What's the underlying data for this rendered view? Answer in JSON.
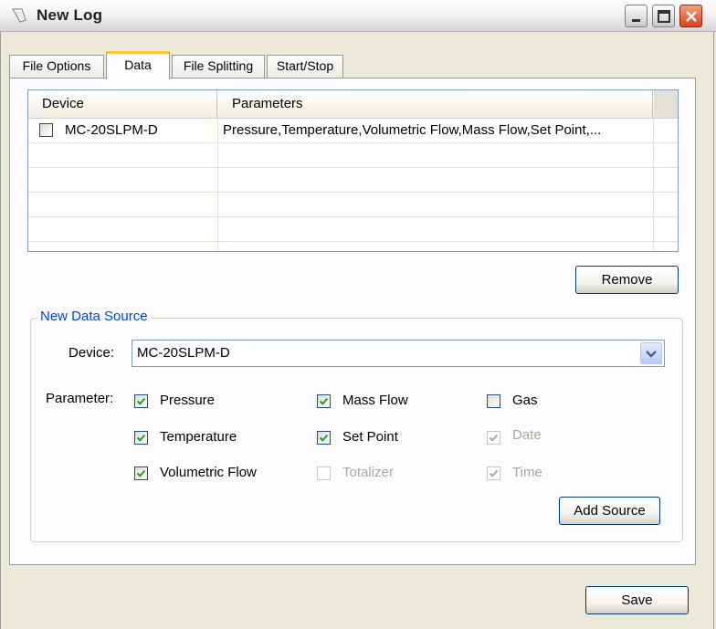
{
  "window": {
    "title": "New Log"
  },
  "tabs": [
    {
      "label": "File Options",
      "active": false
    },
    {
      "label": "Data",
      "active": true
    },
    {
      "label": "File Splitting",
      "active": false
    },
    {
      "label": "Start/Stop",
      "active": false
    }
  ],
  "grid": {
    "columns": [
      "Device",
      "Parameters"
    ],
    "rows": [
      {
        "checked": false,
        "device": "MC-20SLPM-D",
        "parameters": "Pressure,Temperature,Volumetric Flow,Mass Flow,Set Point,..."
      }
    ]
  },
  "buttons": {
    "remove": "Remove",
    "add_source": "Add Source",
    "save": "Save"
  },
  "new_source": {
    "legend": "New Data Source",
    "device_label": "Device:",
    "device_value": "MC-20SLPM-D",
    "parameter_label": "Parameter:",
    "parameters": {
      "pressure": {
        "label": "Pressure",
        "checked": true,
        "enabled": true
      },
      "temperature": {
        "label": "Temperature",
        "checked": true,
        "enabled": true
      },
      "volumetric_flow": {
        "label": "Volumetric Flow",
        "checked": true,
        "enabled": true
      },
      "mass_flow": {
        "label": "Mass Flow",
        "checked": true,
        "enabled": true
      },
      "set_point": {
        "label": "Set Point",
        "checked": true,
        "enabled": true
      },
      "totalizer": {
        "label": "Totalizer",
        "checked": false,
        "enabled": false
      },
      "gas": {
        "label": "Gas",
        "checked": false,
        "enabled": true
      },
      "date": {
        "label": "Date",
        "checked": true,
        "enabled": false
      },
      "time": {
        "label": "Time",
        "checked": true,
        "enabled": false
      }
    }
  },
  "colors": {
    "accent_legend": "#0046D5",
    "active_tab_highlight": "#FFC83C",
    "check_enabled": "#21A121",
    "check_disabled": "#ACA899"
  }
}
